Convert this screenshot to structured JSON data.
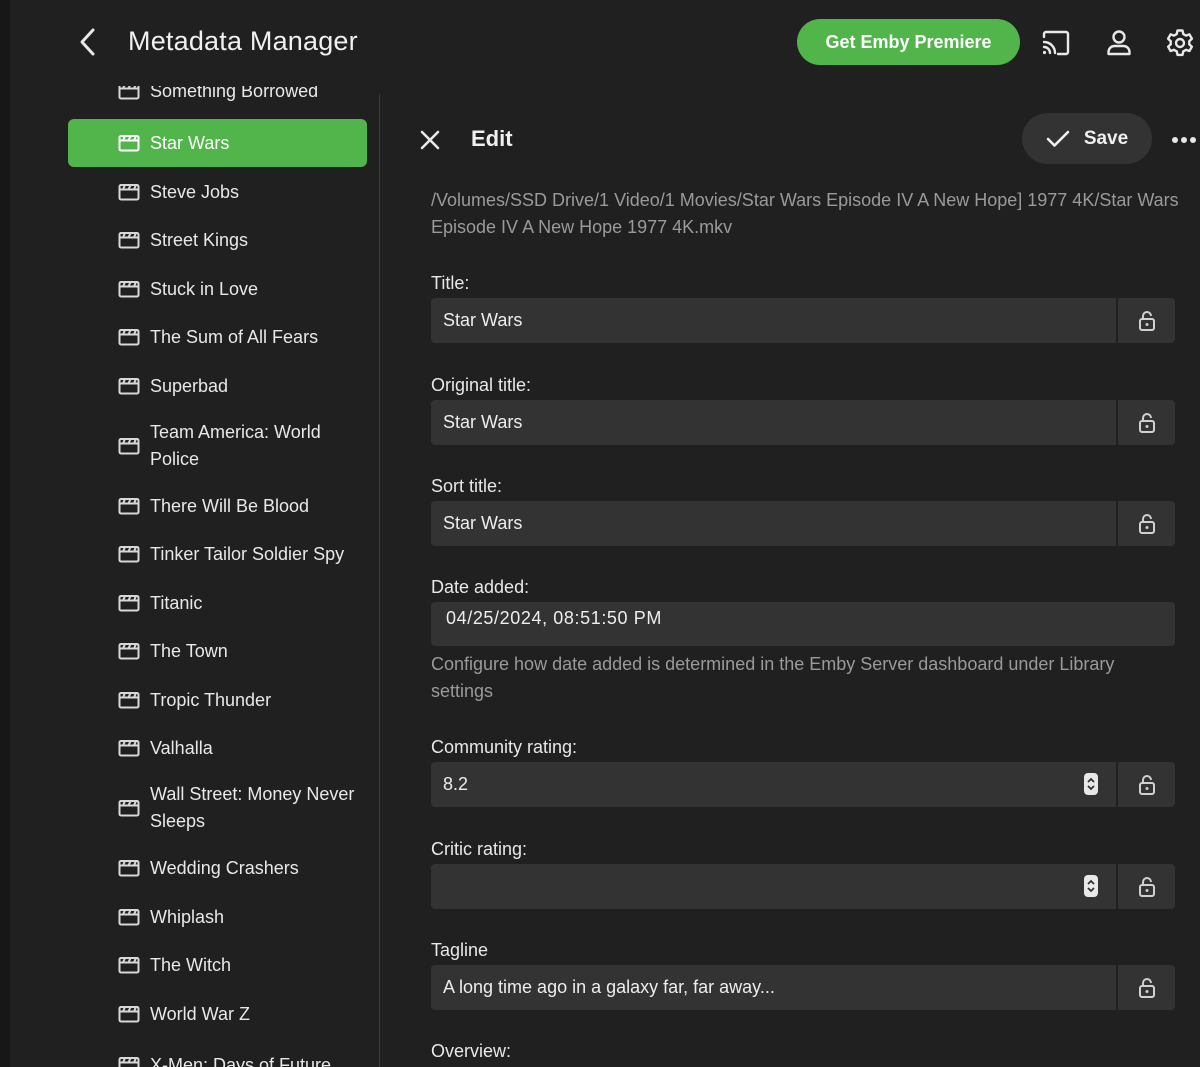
{
  "header": {
    "title": "Metadata Manager",
    "premiere_label": "Get Emby Premiere",
    "icons": [
      "back-icon",
      "cast-icon",
      "user-icon",
      "settings-icon"
    ]
  },
  "sidebar": {
    "items": [
      {
        "label": "Something Borrowed",
        "active": false
      },
      {
        "label": "Star Wars",
        "active": true
      },
      {
        "label": "Steve Jobs",
        "active": false
      },
      {
        "label": "Street Kings",
        "active": false
      },
      {
        "label": "Stuck in Love",
        "active": false
      },
      {
        "label": "The Sum of All Fears",
        "active": false
      },
      {
        "label": "Superbad",
        "active": false
      },
      {
        "label": "Team America: World Police",
        "active": false
      },
      {
        "label": "There Will Be Blood",
        "active": false
      },
      {
        "label": "Tinker Tailor Soldier Spy",
        "active": false
      },
      {
        "label": "Titanic",
        "active": false
      },
      {
        "label": "The Town",
        "active": false
      },
      {
        "label": "Tropic Thunder",
        "active": false
      },
      {
        "label": "Valhalla",
        "active": false
      },
      {
        "label": "Wall Street: Money Never Sleeps",
        "active": false
      },
      {
        "label": "Wedding Crashers",
        "active": false
      },
      {
        "label": "Whiplash",
        "active": false
      },
      {
        "label": "The Witch",
        "active": false
      },
      {
        "label": "World War Z",
        "active": false
      },
      {
        "label": "X-Men: Days of Future",
        "active": false
      }
    ]
  },
  "editor": {
    "title": "Edit",
    "save_label": "Save",
    "file_path": "/Volumes/SSD Drive/1 Video/1 Movies/Star Wars Episode IV A New Hope] 1977 4K/Star Wars Episode IV A New Hope 1977 4K.mkv",
    "fields": {
      "title": {
        "label": "Title:",
        "value": "Star Wars"
      },
      "original_title": {
        "label": "Original title:",
        "value": "Star Wars"
      },
      "sort_title": {
        "label": "Sort title:",
        "value": "Star Wars"
      },
      "date_added": {
        "label": "Date added:",
        "value": "04/25/2024, 08:51:50 PM",
        "help": "Configure how date added is determined in the Emby Server dashboard under Library settings"
      },
      "community_rating": {
        "label": "Community rating:",
        "value": "8.2"
      },
      "critic_rating": {
        "label": "Critic rating:",
        "value": ""
      },
      "tagline": {
        "label": "Tagline",
        "value": "A long time ago in a galaxy far, far away..."
      },
      "overview": {
        "label": "Overview:"
      }
    }
  },
  "colors": {
    "accent": "#52b54b",
    "background": "#202020",
    "field": "#333333",
    "muted_text": "#9a9a9a"
  }
}
